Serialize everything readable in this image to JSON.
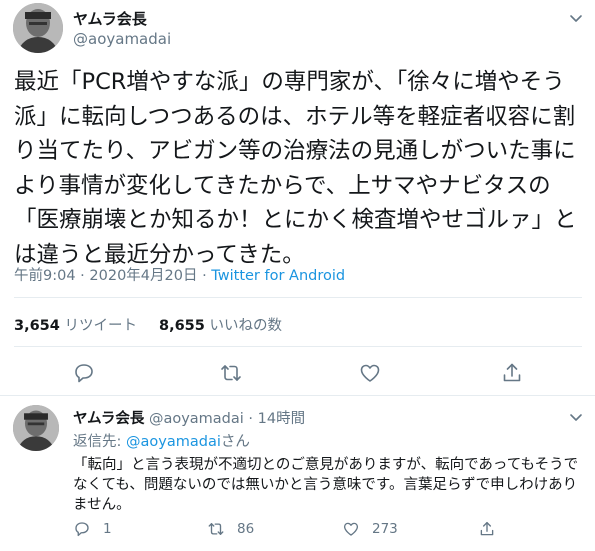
{
  "main_tweet": {
    "display_name": "ヤムラ会長",
    "handle": "@aoyamadai",
    "text": "最近「PCR増やすな派」の専門家が、「徐々に増やそう派」に転向しつつあるのは、ホテル等を軽症者収容に割り当てたり、アビガン等の治療法の見通しがついた事により事情が変化してきたからで、上サマやナビタスの「医療崩壊とか知るか！とにかく検査増やせゴルァ」とは違うと最近分かってきた。",
    "time": "午前9:04",
    "date": "2020年4月20日",
    "separator": " · ",
    "source": "Twitter for Android",
    "retweet_count": "3,654",
    "retweet_label": "リツイート",
    "like_count": "8,655",
    "like_label": "いいねの数"
  },
  "reply_tweet": {
    "display_name": "ヤムラ会長",
    "handle": "@aoyamadai",
    "separator": " · ",
    "age": "14時間",
    "reply_to_label": "返信先: ",
    "reply_to_mention": "@aoyamadai",
    "reply_to_suffix": "さん",
    "text": "「転向」と言う表現が不適切とのご意見がありますが、転向であってもそうでなくても、問題ないのでは無いかと言う意味です。言葉足らずで申しわけありません。",
    "reply_count": "1",
    "retweet_count": "86",
    "like_count": "273"
  },
  "icons": {
    "caret": "chevron-down-icon",
    "reply": "comment-icon",
    "retweet": "retweet-icon",
    "like": "heart-icon",
    "share": "share-icon"
  },
  "colors": {
    "text": "#14171a",
    "secondary": "#657786",
    "link": "#1b95e0",
    "divider": "#e6ecf0"
  }
}
